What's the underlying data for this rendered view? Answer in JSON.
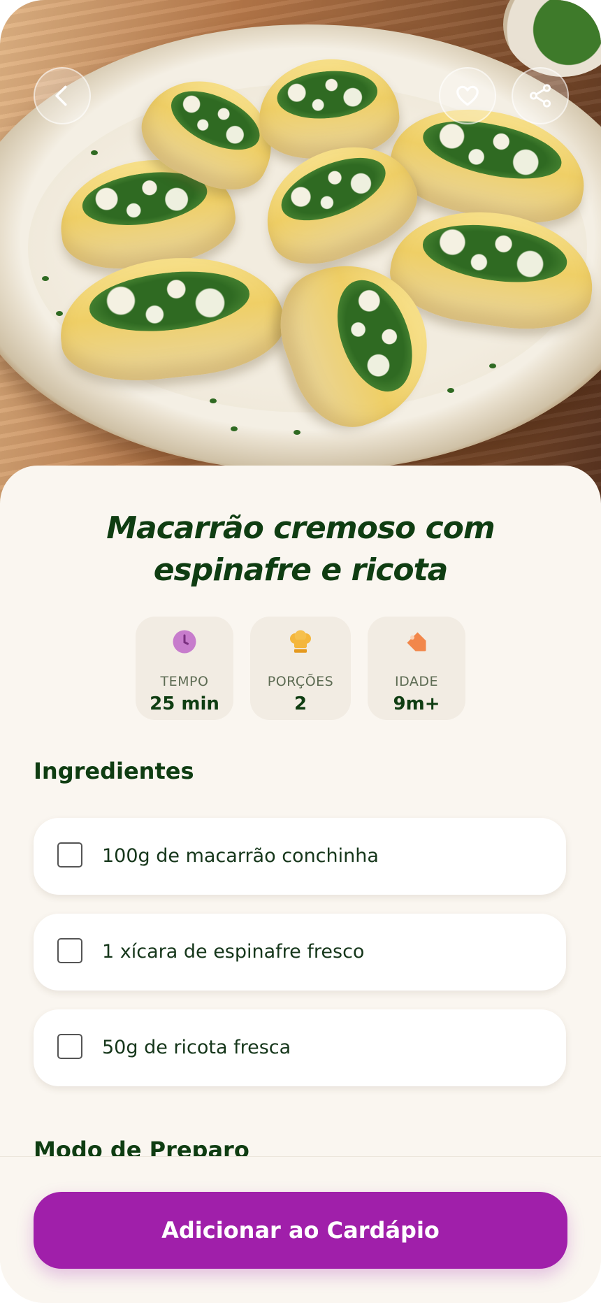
{
  "recipe": {
    "title": "Macarrão cremoso com espinafre e ricota"
  },
  "stats": [
    {
      "label": "TEMPO",
      "value": "25 min",
      "icon": "clock-icon",
      "color": "#c77ccc"
    },
    {
      "label": "PORÇÕES",
      "value": "2",
      "icon": "chef-hat-icon",
      "color": "#f4b63c"
    },
    {
      "label": "IDADE",
      "value": "9m+",
      "icon": "tag-icon",
      "color": "#f2874b"
    }
  ],
  "ingredients": {
    "title": "Ingredientes",
    "items": [
      {
        "text": "100g de macarrão conchinha",
        "checked": false
      },
      {
        "text": "1 xícara de espinafre fresco",
        "checked": false
      },
      {
        "text": "50g de ricota fresca",
        "checked": false
      }
    ]
  },
  "preparation": {
    "title": "Modo de Preparo"
  },
  "actions": {
    "add_to_menu": "Adicionar ao Cardápio"
  },
  "colors": {
    "primary": "#a01faa",
    "title_text": "#0f3d12",
    "background": "#faf6f0"
  }
}
